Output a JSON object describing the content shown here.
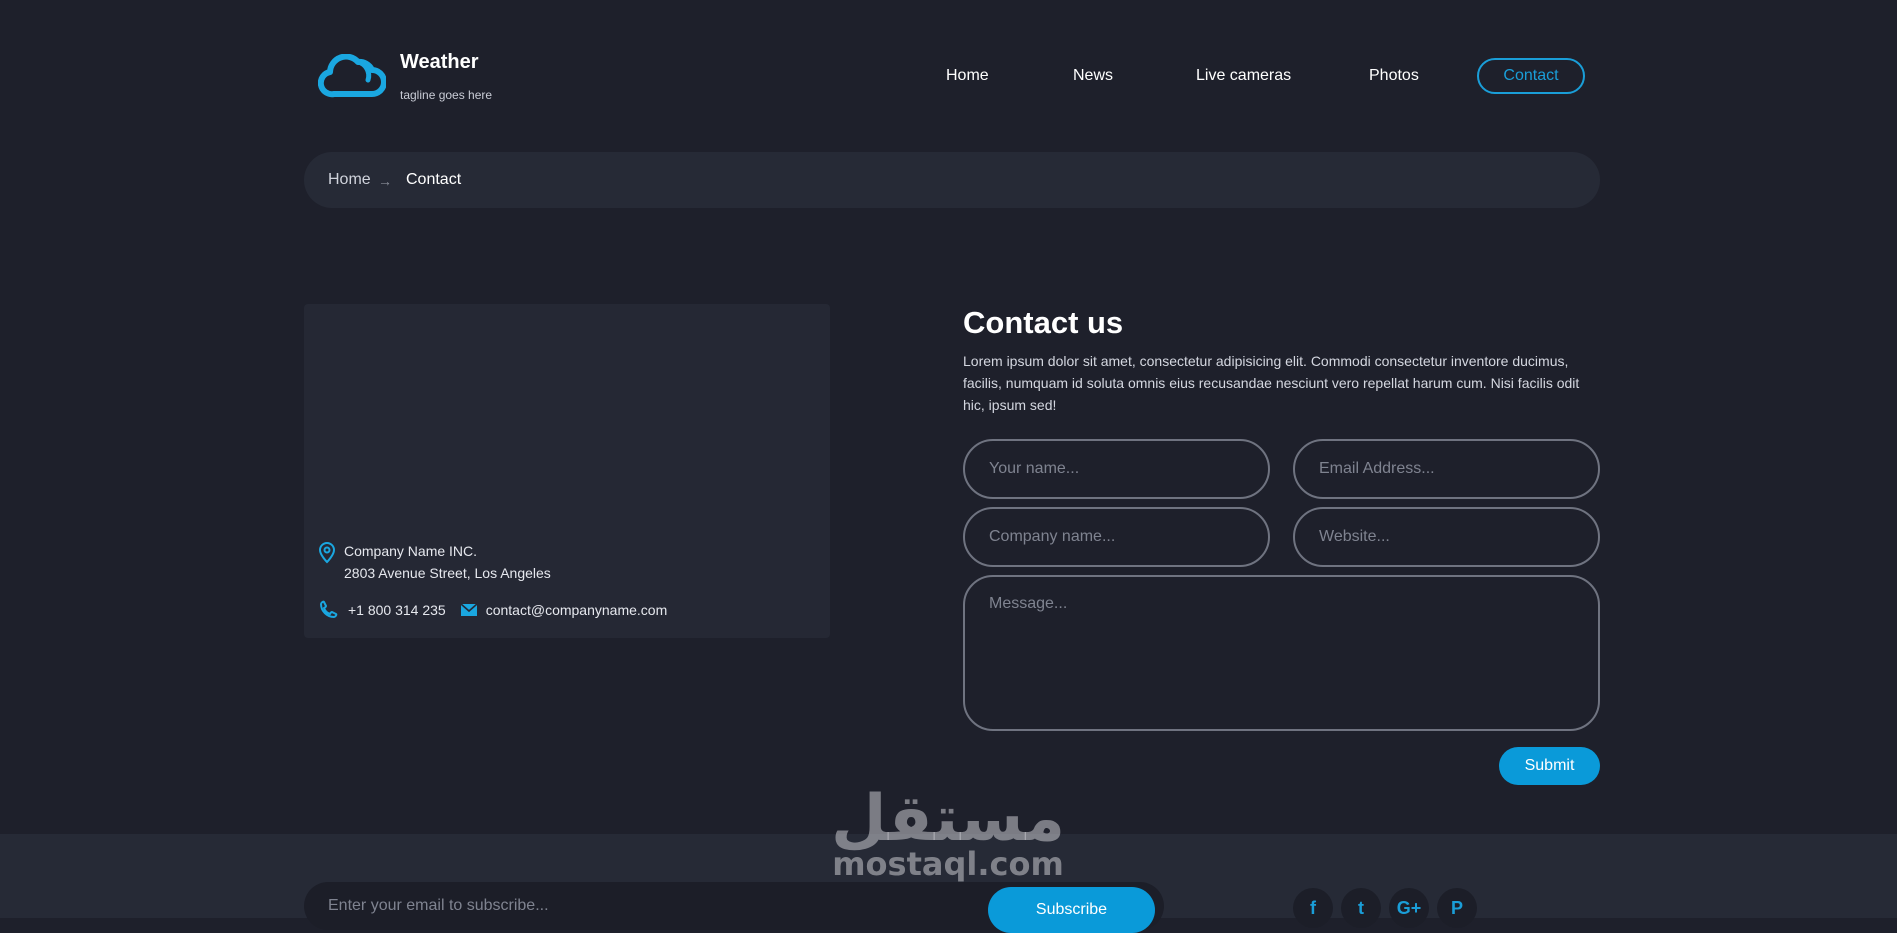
{
  "header": {
    "site_title": "Weather",
    "tagline": "tagline goes here",
    "logo_icon": "cloud-icon",
    "nav": [
      "Home",
      "News",
      "Live cameras",
      "Photos",
      "Contact"
    ],
    "active_nav": "Contact"
  },
  "breadcrumb": {
    "home": "Home",
    "separator": "→",
    "current": "Contact"
  },
  "info": {
    "company": "Company Name INC.",
    "address": "2803 Avenue Street, Los Angeles",
    "phone": "+1 800 314 235",
    "email": "contact@companyname.com"
  },
  "contact": {
    "title": "Contact us",
    "description": "Lorem ipsum dolor sit amet, consectetur adipisicing elit. Commodi consectetur inventore ducimus, facilis, numquam id soluta omnis eius recusandae nesciunt vero repellat harum cum. Nisi facilis odit hic, ipsum sed!",
    "name_placeholder": "Your name...",
    "email_placeholder": "Email Address...",
    "company_placeholder": "Company name...",
    "website_placeholder": "Website...",
    "message_placeholder": "Message...",
    "submit_label": "Submit"
  },
  "footer": {
    "subscribe_placeholder": "Enter your email to subscribe...",
    "subscribe_label": "Subscribe",
    "social": [
      "facebook-icon",
      "twitter-icon",
      "google-plus-icon",
      "pinterest-icon"
    ],
    "social_glyphs": [
      "f",
      "t",
      "G+",
      "P"
    ]
  },
  "watermark": {
    "arabic": "مستقل",
    "latin": "mostaql.com"
  },
  "colors": {
    "background": "#1e202b",
    "panel": "#262a36",
    "accent": "#0a9ad9"
  }
}
